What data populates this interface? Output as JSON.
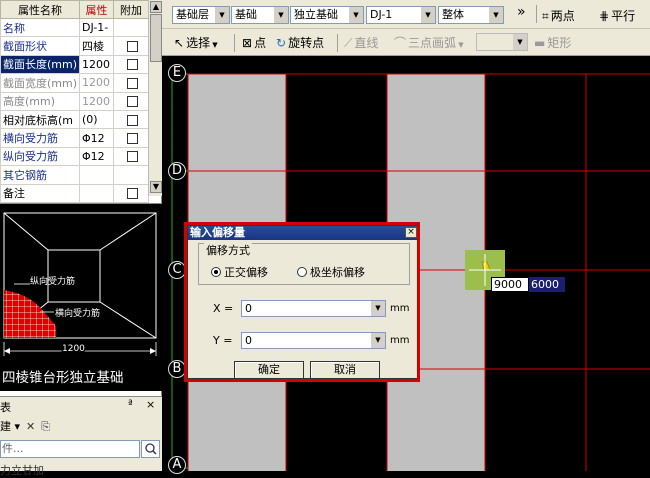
{
  "properties": {
    "header_name": "属性名称",
    "header_attr": "属性",
    "header_extra": "附加",
    "rows": [
      {
        "name": "名称",
        "value": "DJ-1-"
      },
      {
        "name": "截面形状",
        "value": "四棱"
      },
      {
        "name": "截面长度(mm)",
        "value": "1200"
      },
      {
        "name": "截面宽度(mm)",
        "value": "1200"
      },
      {
        "name": "高度(mm)",
        "value": "1200"
      },
      {
        "name": "相对底标高(m",
        "value": "(0)"
      },
      {
        "name": "横向受力筋",
        "value": "Φ12"
      },
      {
        "name": "纵向受力筋",
        "value": "Φ12"
      },
      {
        "name": "其它钢筋",
        "value": ""
      },
      {
        "name": "备注",
        "value": ""
      }
    ]
  },
  "preview": {
    "label_longitudinal": "纵向受力筋",
    "label_transverse": "横向受力筋",
    "dimension": "1200",
    "caption": "四棱锥台形独立基础"
  },
  "bottom_panel": {
    "title": "表",
    "pin": "ª",
    "close": "×",
    "tools_new": "建 ▾",
    "tools_delete": "✕",
    "tools_copy": "⎘",
    "search_placeholder": "件...",
    "last_item": "力立甘加"
  },
  "toolbar1": {
    "layer": "基础层",
    "category": "基础",
    "type": "独立基础",
    "element": "DJ-1",
    "part": "整体",
    "more": "»",
    "two_point": "两点",
    "parallel": "平行"
  },
  "toolbar2": {
    "select": "选择",
    "point": "点",
    "rotate_point": "旋转点",
    "line": "直线",
    "three_point_arc": "三点画弧",
    "rectangle": "矩形"
  },
  "canvas": {
    "axes": [
      "E",
      "D",
      "C",
      "B",
      "A"
    ],
    "input_x": "9000",
    "input_y": "6000"
  },
  "dialog": {
    "title": "输入偏移量",
    "close": "×",
    "group_label": "偏移方式",
    "radio_orthogonal": "正交偏移",
    "radio_polar": "极坐标偏移",
    "x_label": "X =",
    "x_value": "0",
    "y_label": "Y =",
    "y_value": "0",
    "unit_x": "mm",
    "unit_y": "mm",
    "ok": "确定",
    "cancel": "取消"
  }
}
